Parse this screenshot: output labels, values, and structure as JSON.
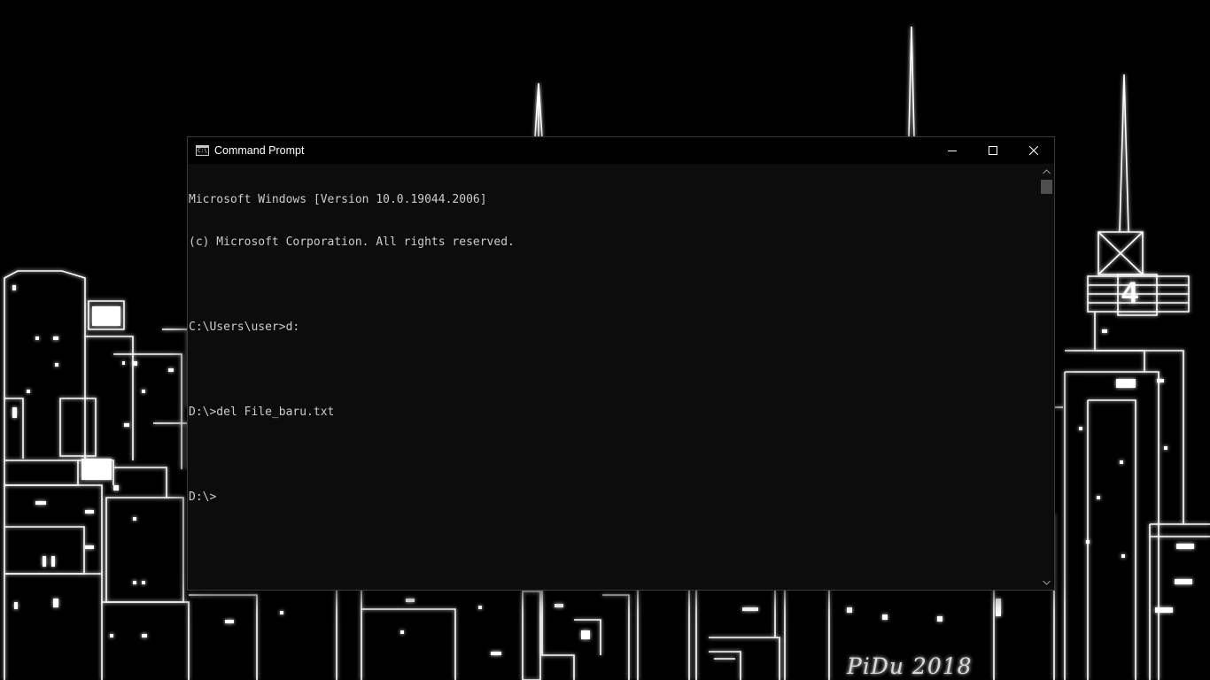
{
  "window": {
    "title": "Command Prompt",
    "icon": "cmd-icon",
    "icon_text": "C:\\",
    "controls": [
      "minimize-icon",
      "maximize-icon",
      "close-icon"
    ]
  },
  "console": {
    "lines": [
      "Microsoft Windows [Version 10.0.19044.2006]",
      "(c) Microsoft Corporation. All rights reserved.",
      "",
      "C:\\Users\\user>d:",
      "",
      "D:\\>del File_baru.txt",
      "",
      "D:\\>"
    ],
    "background": "#0c0c0c",
    "foreground": "#cccccc"
  },
  "wallpaper": {
    "signature": "PiDu 2018",
    "building_number": "4",
    "style": "white neon city skyline on black"
  }
}
